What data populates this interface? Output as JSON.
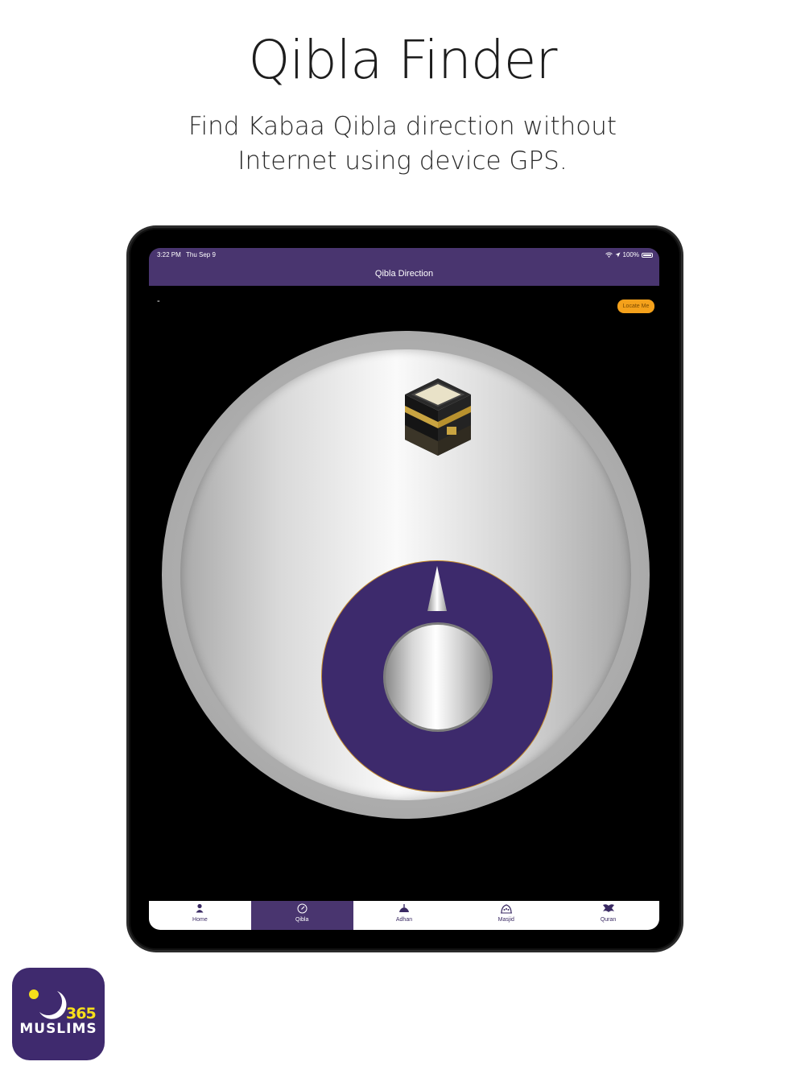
{
  "promo": {
    "title": "Qibla Finder",
    "subtitle_line1": "Find Kabaa Qibla direction without",
    "subtitle_line2": "Internet using device GPS."
  },
  "status_bar": {
    "time": "3:22 PM",
    "date": "Thu Sep 9",
    "battery": "100%"
  },
  "nav": {
    "title": "Qibla Direction"
  },
  "screen": {
    "location_text": "-",
    "locate_button": "Locate Me"
  },
  "tabs": [
    {
      "label": "Home",
      "icon": "person-icon",
      "glyph": "👤"
    },
    {
      "label": "Qibla",
      "icon": "compass-icon",
      "glyph": "⊘"
    },
    {
      "label": "Adhan",
      "icon": "mosque-icon",
      "glyph": "☗"
    },
    {
      "label": "Masjid",
      "icon": "masjid-icon",
      "glyph": "⌂"
    },
    {
      "label": "Quran",
      "icon": "quran-icon",
      "glyph": "✦"
    }
  ],
  "active_tab": "Qibla",
  "logo": {
    "number": "365",
    "word": "MUSLIMS"
  },
  "colors": {
    "brand_purple": "#49356f",
    "dial_purple": "#3d2a6c",
    "locate_orange": "#f4a11b",
    "logo_yellow": "#f6df1b"
  }
}
